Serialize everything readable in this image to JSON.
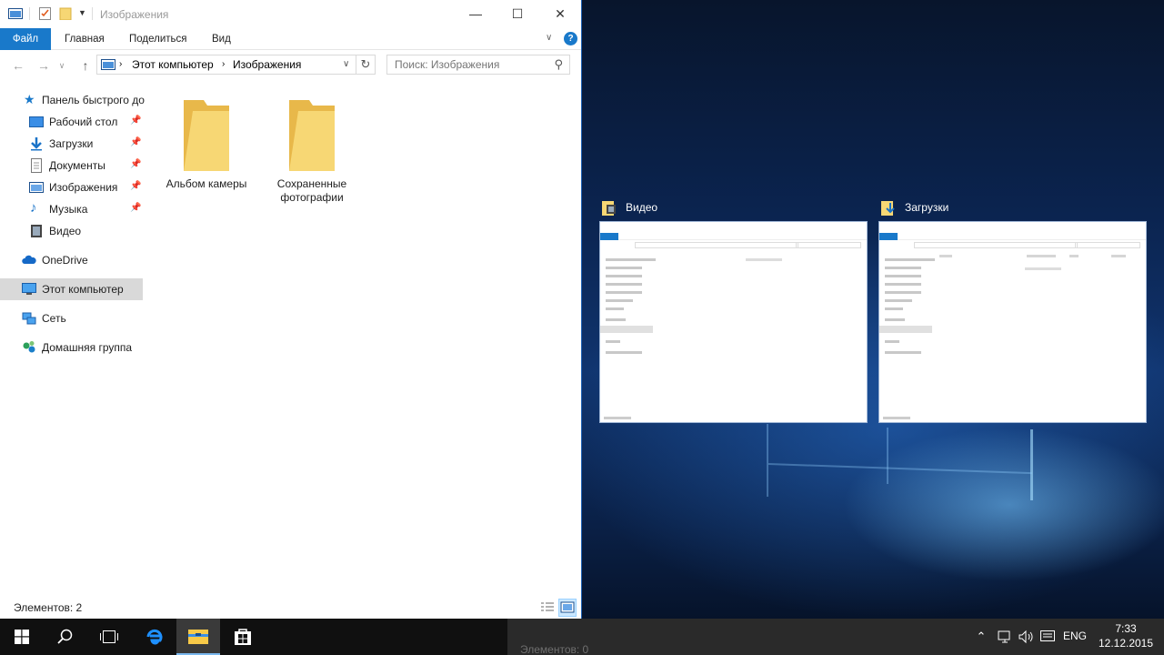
{
  "window": {
    "title": "Изображения",
    "ribbon_tabs": {
      "file": "Файл",
      "home": "Главная",
      "share": "Поделиться",
      "view": "Вид"
    },
    "help_label": "?",
    "address": {
      "root": "Этот компьютер",
      "current": "Изображения"
    },
    "search_placeholder": "Поиск: Изображения",
    "nav": {
      "quick_access": "Панель быстрого до",
      "desktop": "Рабочий стол",
      "downloads": "Загрузки",
      "documents": "Документы",
      "pictures": "Изображения",
      "music": "Музыка",
      "videos": "Видео",
      "onedrive": "OneDrive",
      "this_pc": "Этот компьютер",
      "network": "Сеть",
      "homegroup": "Домашняя группа"
    },
    "folders": [
      {
        "name": "Альбом камеры"
      },
      {
        "name": "Сохраненные фотографии"
      }
    ],
    "status": "Элементов: 2"
  },
  "snap_assist": {
    "windows": [
      {
        "title": "Видео",
        "status": "Элементов: 0"
      },
      {
        "title": "Загрузки",
        "status": "Элементов: 0"
      }
    ]
  },
  "taskbar": {
    "ghost_status": "Элементов: 0",
    "language": "ENG",
    "time": "7:33",
    "date": "12.12.2015"
  },
  "colors": {
    "accent": "#1979ca",
    "folder": "#f7d774",
    "taskbar": "#101010"
  },
  "icons": {
    "tray": [
      "chevron-up-icon",
      "network-icon",
      "volume-icon",
      "notification-icon"
    ]
  }
}
